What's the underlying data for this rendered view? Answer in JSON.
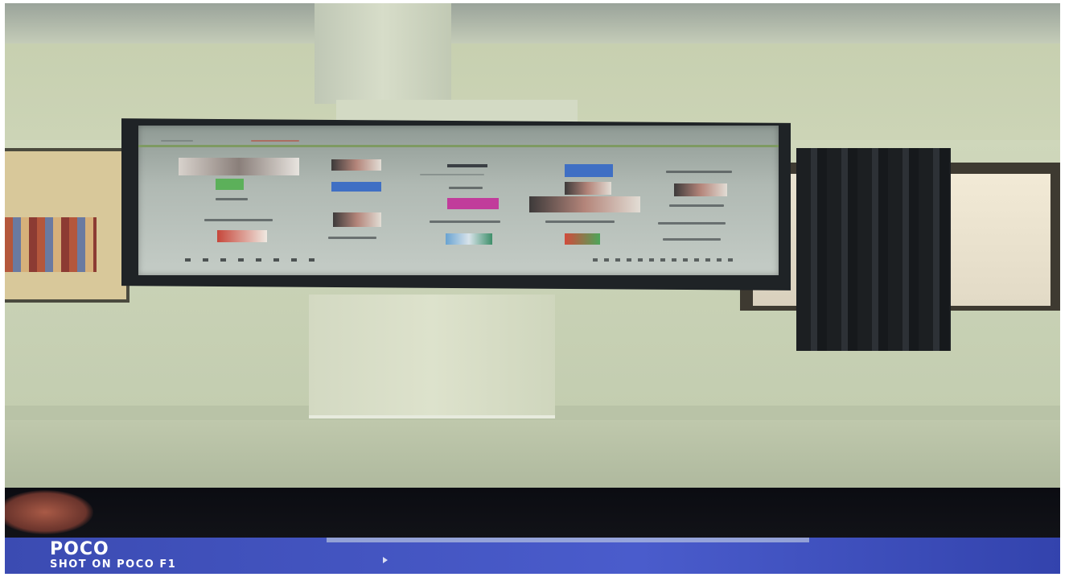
{
  "watermark": {
    "brand": "POCO",
    "caption": "SHOT ON POCO F1"
  },
  "colors": {
    "wall": "#c9d2b4",
    "screen": "#b0b9b3",
    "curtain": "#1c1f22",
    "monitor_screen": "#4a5ccc"
  },
  "scene": {
    "projected_meeting_grid": "video-call participant gallery (text illegible)"
  }
}
